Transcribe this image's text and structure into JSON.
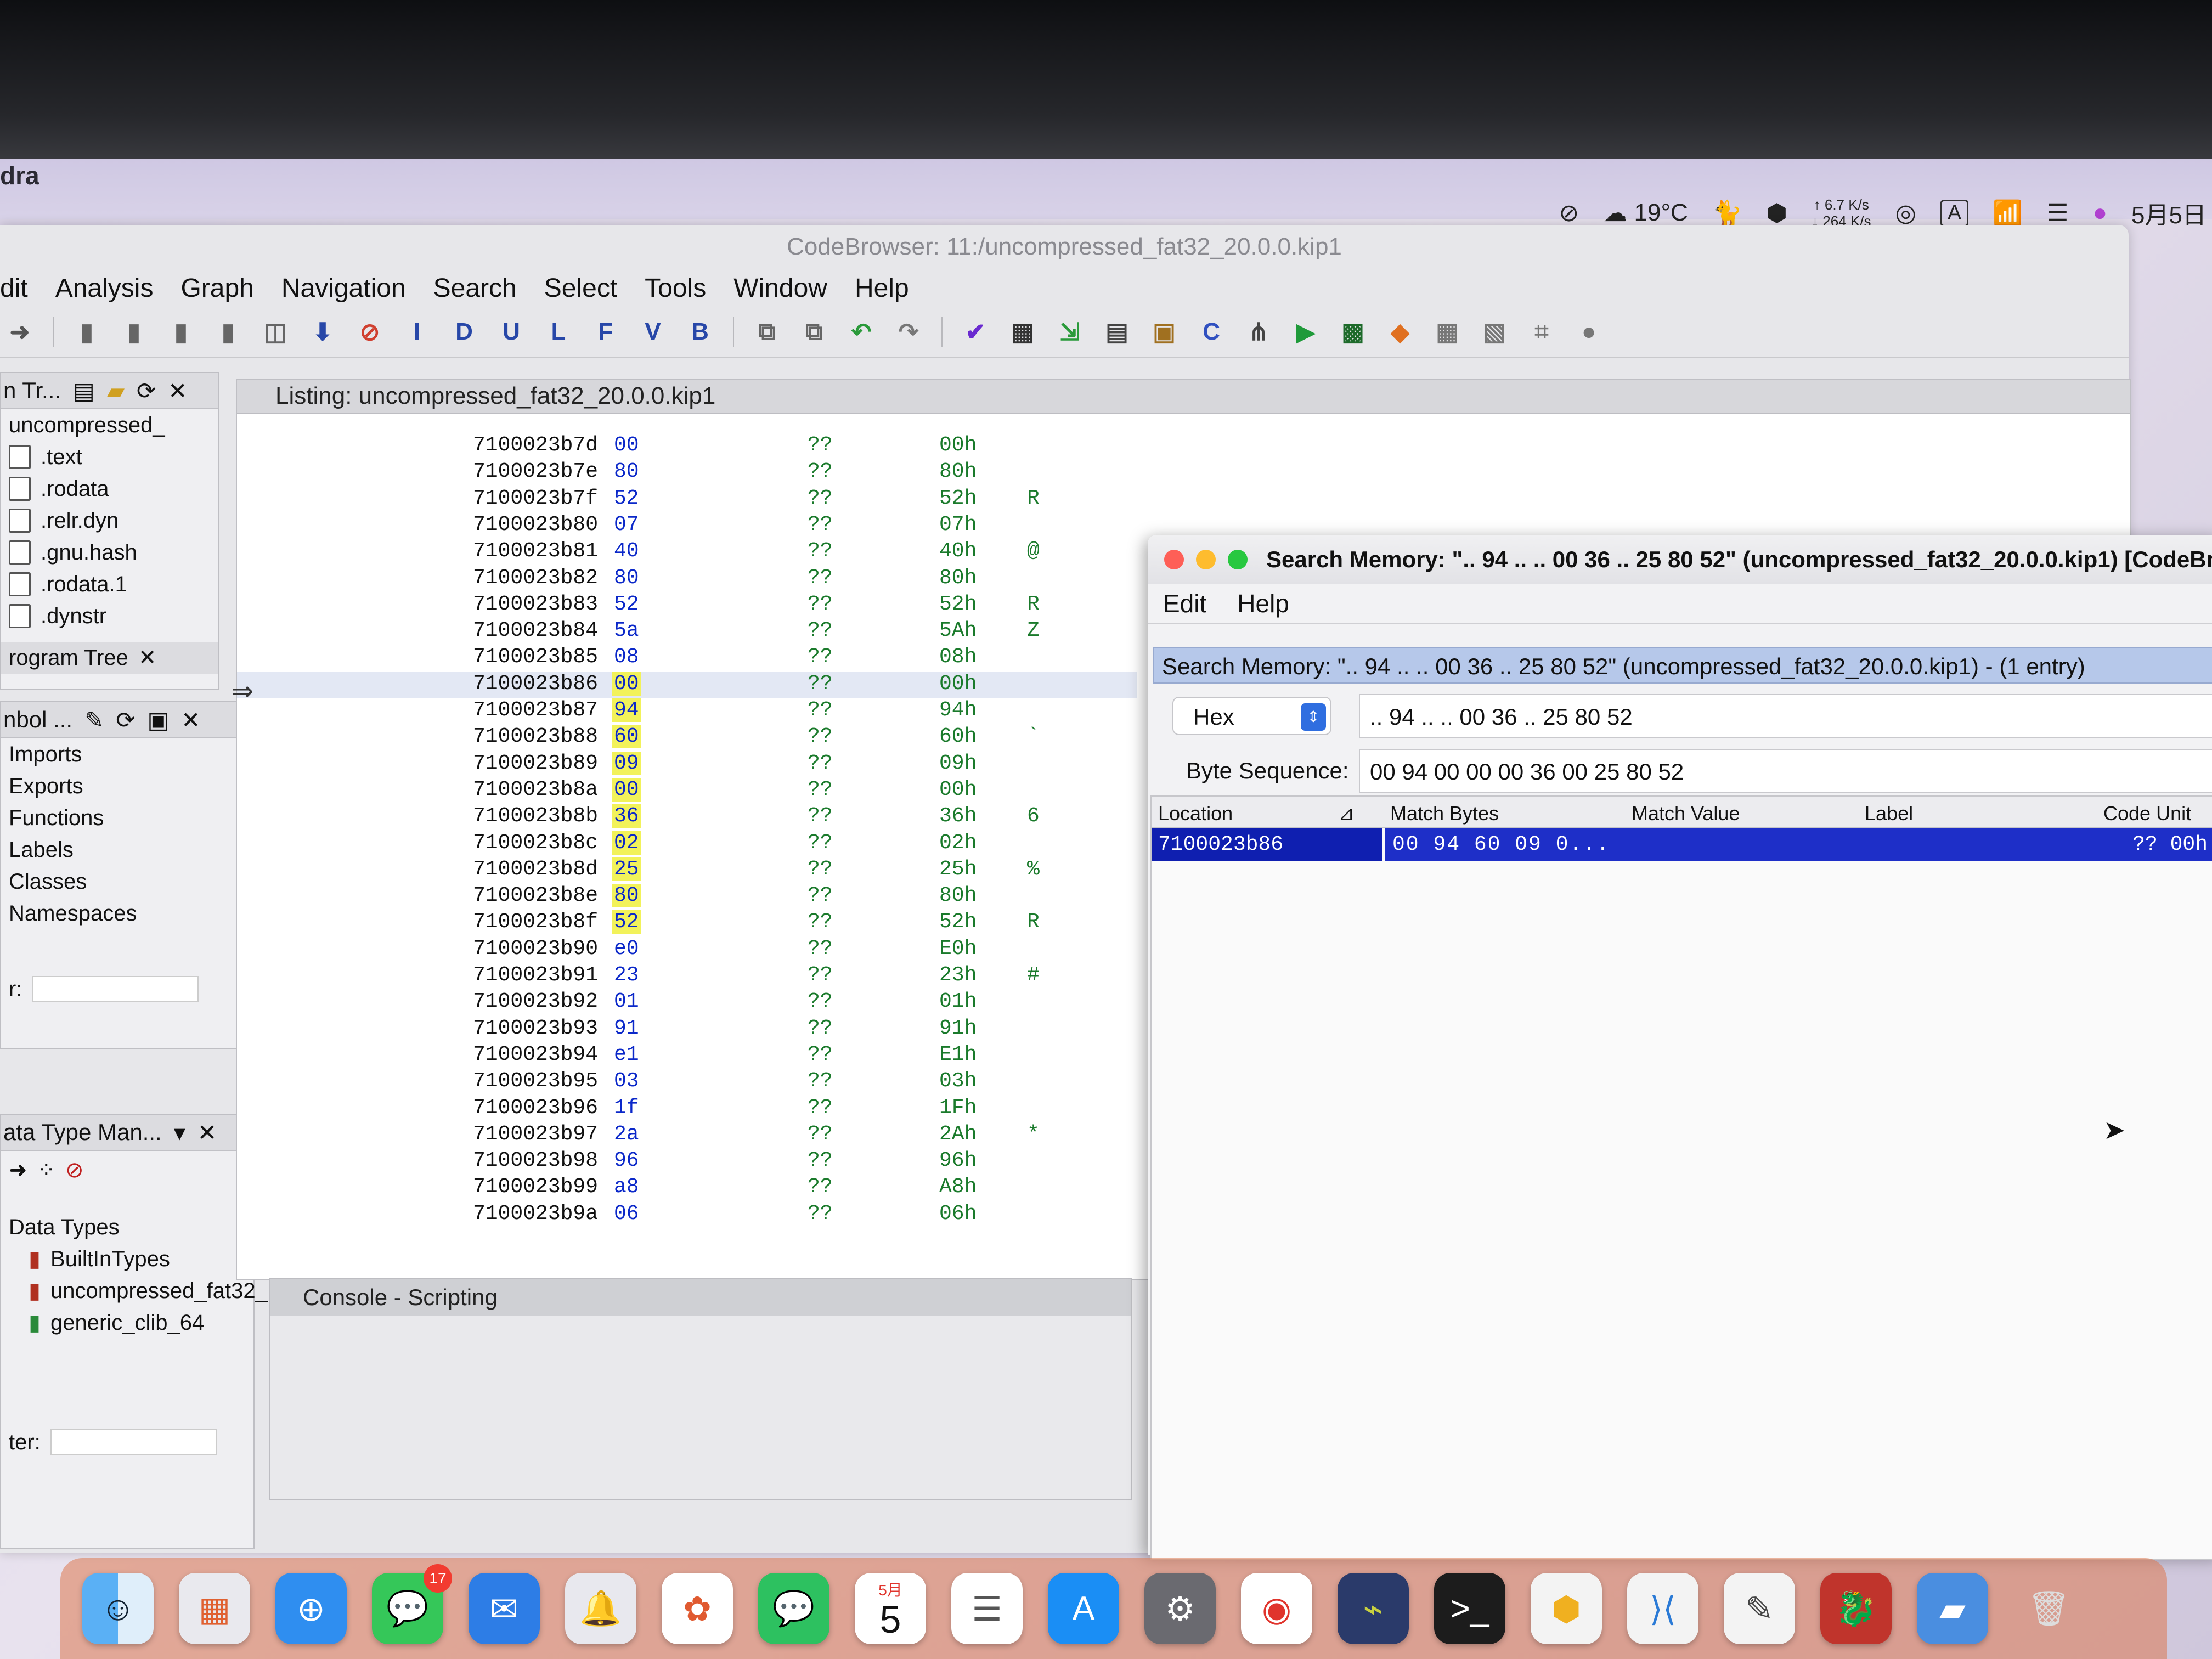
{
  "menubar": {
    "app_name": "dra",
    "weather": "19°C",
    "net_up": "↑ 6.7 K/s",
    "net_down": "↓ 264 K/s",
    "input_mode": "A",
    "date": "5月5日"
  },
  "ghidra": {
    "title": "CodeBrowser: 11:/uncompressed_fat32_20.0.0.kip1",
    "menus": [
      "dit",
      "Analysis",
      "Graph",
      "Navigation",
      "Search",
      "Select",
      "Tools",
      "Window",
      "Help"
    ],
    "toolbar_letters": [
      "I",
      "D",
      "U",
      "L",
      "F",
      "V",
      "B"
    ],
    "program_tree_header": "n Tr...",
    "program_tree_items": [
      "uncompressed_",
      ".text",
      ".rodata",
      ".relr.dyn",
      ".gnu.hash",
      ".rodata.1",
      ".dynstr"
    ],
    "program_tree_tab": "rogram Tree",
    "symbol_header": "nbol ...",
    "symbol_items": [
      "Imports",
      "Exports",
      "Functions",
      "Labels",
      "Classes",
      "Namespaces"
    ],
    "filter_label": "r:",
    "datatype_header": "ata Type Man...",
    "datatype_items": [
      "Data Types",
      "BuiltInTypes",
      "uncompressed_fat32_",
      "generic_clib_64"
    ],
    "filter2_label": "ter:",
    "listing_title": "Listing:  uncompressed_fat32_20.0.0.kip1",
    "console_title": "Console - Scripting"
  },
  "listing_rows": [
    {
      "addr": "7100023b7d",
      "byte": "00",
      "q": "??",
      "hex": "00h",
      "ch": ""
    },
    {
      "addr": "7100023b7e",
      "byte": "80",
      "q": "??",
      "hex": "80h",
      "ch": ""
    },
    {
      "addr": "7100023b7f",
      "byte": "52",
      "q": "??",
      "hex": "52h",
      "ch": "R"
    },
    {
      "addr": "7100023b80",
      "byte": "07",
      "q": "??",
      "hex": "07h",
      "ch": ""
    },
    {
      "addr": "7100023b81",
      "byte": "40",
      "q": "??",
      "hex": "40h",
      "ch": "@"
    },
    {
      "addr": "7100023b82",
      "byte": "80",
      "q": "??",
      "hex": "80h",
      "ch": ""
    },
    {
      "addr": "7100023b83",
      "byte": "52",
      "q": "??",
      "hex": "52h",
      "ch": "R"
    },
    {
      "addr": "7100023b84",
      "byte": "5a",
      "q": "??",
      "hex": "5Ah",
      "ch": "Z"
    },
    {
      "addr": "7100023b85",
      "byte": "08",
      "q": "??",
      "hex": "08h",
      "ch": ""
    },
    {
      "addr": "7100023b86",
      "byte": "00",
      "q": "??",
      "hex": "00h",
      "ch": ""
    },
    {
      "addr": "7100023b87",
      "byte": "94",
      "q": "??",
      "hex": "94h",
      "ch": ""
    },
    {
      "addr": "7100023b88",
      "byte": "60",
      "q": "??",
      "hex": "60h",
      "ch": "`"
    },
    {
      "addr": "7100023b89",
      "byte": "09",
      "q": "??",
      "hex": "09h",
      "ch": ""
    },
    {
      "addr": "7100023b8a",
      "byte": "00",
      "q": "??",
      "hex": "00h",
      "ch": ""
    },
    {
      "addr": "7100023b8b",
      "byte": "36",
      "q": "??",
      "hex": "36h",
      "ch": "6"
    },
    {
      "addr": "7100023b8c",
      "byte": "02",
      "q": "??",
      "hex": "02h",
      "ch": ""
    },
    {
      "addr": "7100023b8d",
      "byte": "25",
      "q": "??",
      "hex": "25h",
      "ch": "%"
    },
    {
      "addr": "7100023b8e",
      "byte": "80",
      "q": "??",
      "hex": "80h",
      "ch": ""
    },
    {
      "addr": "7100023b8f",
      "byte": "52",
      "q": "??",
      "hex": "52h",
      "ch": "R"
    },
    {
      "addr": "7100023b90",
      "byte": "e0",
      "q": "??",
      "hex": "E0h",
      "ch": ""
    },
    {
      "addr": "7100023b91",
      "byte": "23",
      "q": "??",
      "hex": "23h",
      "ch": "#"
    },
    {
      "addr": "7100023b92",
      "byte": "01",
      "q": "??",
      "hex": "01h",
      "ch": ""
    },
    {
      "addr": "7100023b93",
      "byte": "91",
      "q": "??",
      "hex": "91h",
      "ch": ""
    },
    {
      "addr": "7100023b94",
      "byte": "e1",
      "q": "??",
      "hex": "E1h",
      "ch": ""
    },
    {
      "addr": "7100023b95",
      "byte": "03",
      "q": "??",
      "hex": "03h",
      "ch": ""
    },
    {
      "addr": "7100023b96",
      "byte": "1f",
      "q": "??",
      "hex": "1Fh",
      "ch": ""
    },
    {
      "addr": "7100023b97",
      "byte": "2a",
      "q": "??",
      "hex": "2Ah",
      "ch": "*"
    },
    {
      "addr": "7100023b98",
      "byte": "96",
      "q": "??",
      "hex": "96h",
      "ch": ""
    },
    {
      "addr": "7100023b99",
      "byte": "a8",
      "q": "??",
      "hex": "A8h",
      "ch": ""
    },
    {
      "addr": "7100023b9a",
      "byte": "06",
      "q": "??",
      "hex": "06h",
      "ch": ""
    }
  ],
  "search_dialog": {
    "title": "Search Memory: \".. 94 .. .. 00 36 .. 25 80 52\" (uncompressed_fat32_20.0.0.kip1) [CodeBr",
    "menus": [
      "Edit",
      "Help"
    ],
    "subtitle": "Search Memory: \".. 94 .. .. 00 36 .. 25 80 52\"  (uncompressed_fat32_20.0.0.kip1) -  (1 entry)",
    "format": "Hex",
    "search_value": ".. 94 .. .. 00 36 .. 25 80 52",
    "byte_seq_label": "Byte Sequence:",
    "byte_seq_value": "00 94 00 00 00 36 00 25 80 52",
    "columns": [
      "Location",
      "Match Bytes",
      "Match Value",
      "Label",
      "Code Unit"
    ],
    "result": {
      "location": "7100023b86",
      "match_bytes": "00 94 60 09 0...",
      "code_unit": "?? 00h"
    }
  },
  "dock": {
    "messages_badge": "17",
    "calendar_month": "5月",
    "calendar_day": "5"
  }
}
